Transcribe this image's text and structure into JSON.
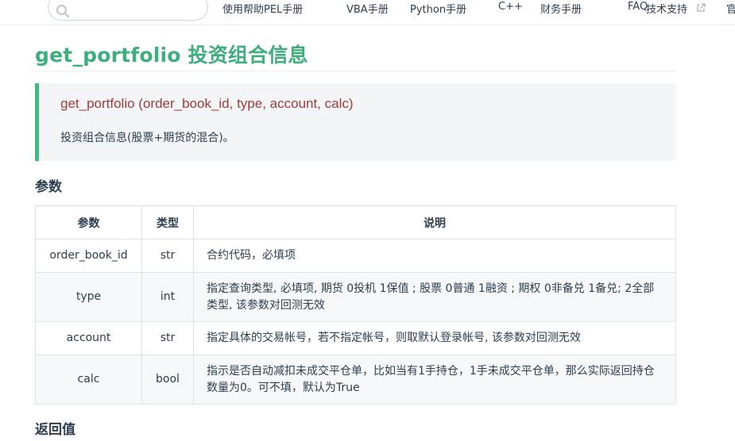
{
  "nav": {
    "items": [
      "使用帮助",
      "PEL手册",
      "VBA手册",
      "Python手册",
      "C++",
      "财务手册",
      "FAQ",
      "技术支持",
      "官"
    ]
  },
  "page": {
    "title": "get_portfolio 投资组合信息",
    "signature": "get_portfolio (order_book_id, type, account, calc)",
    "description": "投资组合信息(股票+期货的混合)。",
    "params_heading": "参数",
    "returns_heading": "返回值"
  },
  "table": {
    "headers": [
      "参数",
      "类型",
      "说明"
    ],
    "rows": [
      [
        "order_book_id",
        "str",
        "合约代码，必填项"
      ],
      [
        "type",
        "int",
        "指定查询类型, 必填项, 期货 0投机 1保值 ; 股票 0普通 1融资 ; 期权 0非备兑 1备兑; 2全部类型, 该参数对回测无效"
      ],
      [
        "account",
        "str",
        "指定具体的交易帐号，若不指定帐号，则取默认登录帐号, 该参数对回测无效"
      ],
      [
        "calc",
        "bool",
        "指示是否自动减扣未成交平仓单，比如当有1手持仓，1手未成交平仓单，那么实际返回持仓数量为0。可不填，默认为True"
      ]
    ]
  },
  "colors": {
    "accent": "#3eaf7c",
    "signature": "#a33b3b",
    "box_border": "#42b983"
  }
}
